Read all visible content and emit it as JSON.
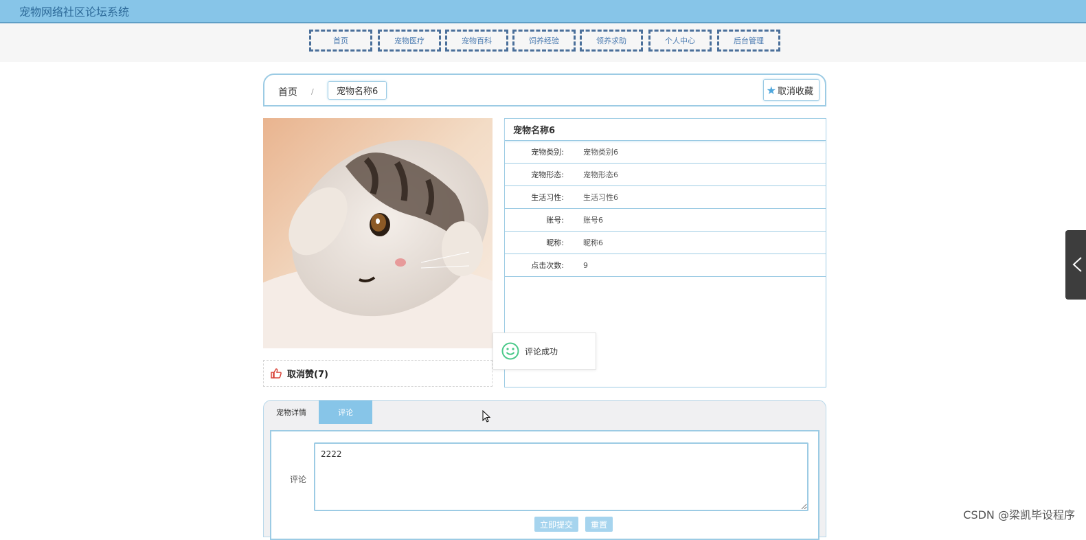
{
  "header": {
    "site_title": "宠物网络社区论坛系统"
  },
  "nav": {
    "items": [
      {
        "label": "首页"
      },
      {
        "label": "宠物医疗"
      },
      {
        "label": "宠物百科"
      },
      {
        "label": "饲养经验"
      },
      {
        "label": "领养求助"
      },
      {
        "label": "个人中心"
      },
      {
        "label": "后台管理"
      }
    ]
  },
  "breadcrumb": {
    "home": "首页",
    "separator": "/",
    "current": "宠物名称6"
  },
  "favorite": {
    "label": "取消收藏",
    "icon": "star-icon"
  },
  "like": {
    "label": "取消赞(7)",
    "icon": "thumbs-up-icon"
  },
  "detail": {
    "title": "宠物名称6",
    "rows": [
      {
        "key": "宠物类别:",
        "value": "宠物类别6"
      },
      {
        "key": "宠物形态:",
        "value": "宠物形态6"
      },
      {
        "key": "生活习性:",
        "value": "生活习性6"
      },
      {
        "key": "账号:",
        "value": "账号6"
      },
      {
        "key": "昵称:",
        "value": "昵称6"
      },
      {
        "key": "点击次数:",
        "value": "9"
      }
    ]
  },
  "toast": {
    "message": "评论成功",
    "icon": "smile-icon"
  },
  "tabs": {
    "items": [
      {
        "label": "宠物详情"
      },
      {
        "label": "评论"
      }
    ],
    "active": "评论"
  },
  "comment_form": {
    "label": "评论",
    "value": "2222",
    "submit_label": "立即提交",
    "reset_label": "重置"
  },
  "watermark": "CSDN @梁凯毕设程序",
  "colors": {
    "primary": "#87c5e8",
    "border": "#9ccbe4",
    "nav_border": "#4a6f9a"
  }
}
